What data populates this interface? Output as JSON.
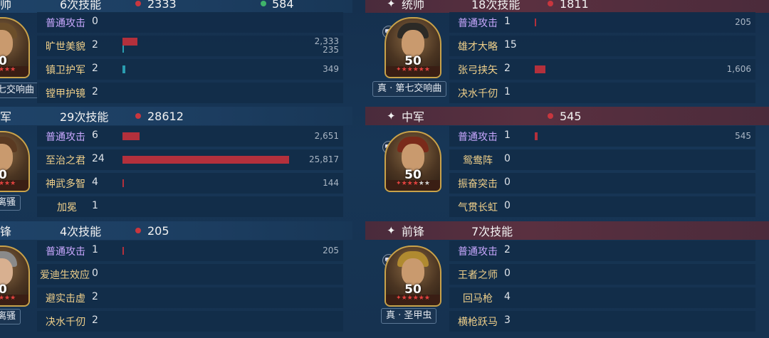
{
  "left": {
    "p1": {
      "header": {
        "role": "帅",
        "skills": "6次技能",
        "damage": "2333",
        "heal": "584"
      },
      "level": "0",
      "skills": [
        {
          "name": "普通攻击",
          "count": "0"
        },
        {
          "name": "旷世美貌",
          "count": "2",
          "value": "2,333",
          "value2": "235"
        },
        {
          "name": "镇卫护军",
          "count": "2",
          "value": "349"
        },
        {
          "name": "镗甲护镜",
          "count": "2"
        }
      ],
      "tag": "七交响曲"
    },
    "p2": {
      "header": {
        "role": "军",
        "skills": "29次技能",
        "damage": "28612"
      },
      "level": "0",
      "skills": [
        {
          "name": "普通攻击",
          "count": "6",
          "value": "2,651"
        },
        {
          "name": "至治之君",
          "count": "24",
          "value": "25,817"
        },
        {
          "name": "神武多智",
          "count": "4",
          "value": "144"
        },
        {
          "name": "加冕",
          "count": "1"
        }
      ],
      "tag": "离骚"
    },
    "p3": {
      "header": {
        "role": "锋",
        "skills": "4次技能",
        "damage": "205"
      },
      "level": "0",
      "skills": [
        {
          "name": "普通攻击",
          "count": "1",
          "value": "205"
        },
        {
          "name": "爱迪生效应",
          "count": "0"
        },
        {
          "name": "避实击虚",
          "count": "2"
        },
        {
          "name": "决水千仞",
          "count": "2"
        }
      ],
      "tag": "离骚"
    }
  },
  "right": {
    "p1": {
      "header": {
        "star": "✦",
        "role": "统帅",
        "skills": "18次技能",
        "damage": "1811"
      },
      "level": "50",
      "skills": [
        {
          "name": "普通攻击",
          "count": "1",
          "value": "205"
        },
        {
          "name": "雄才大略",
          "count": "15"
        },
        {
          "name": "张弓挟矢",
          "count": "2",
          "value": "1,606"
        },
        {
          "name": "决水千仞",
          "count": "1"
        }
      ],
      "tag": "真 · 第七交响曲"
    },
    "p2": {
      "header": {
        "star": "✦",
        "role": "中军",
        "damage": "545"
      },
      "level": "50",
      "skills": [
        {
          "name": "普通攻击",
          "count": "1",
          "value": "545"
        },
        {
          "name": "鸳鸯阵",
          "count": "0"
        },
        {
          "name": "振奋突击",
          "count": "0"
        },
        {
          "name": "气贯长虹",
          "count": "0"
        }
      ]
    },
    "p3": {
      "header": {
        "star": "✦",
        "role": "前锋",
        "skills": "7次技能"
      },
      "level": "50",
      "skills": [
        {
          "name": "普通攻击",
          "count": "2"
        },
        {
          "name": "王者之师",
          "count": "0"
        },
        {
          "name": "回马枪",
          "count": "4"
        },
        {
          "name": "横枪跃马",
          "count": "3"
        }
      ],
      "tag": "真 · 圣甲虫"
    }
  },
  "chart_data": {
    "type": "bar",
    "bars": [
      {
        "skill": "旷世美貌",
        "damage": 2333,
        "heal": 235
      },
      {
        "skill": "镇卫护军",
        "heal": 349
      },
      {
        "skill": "普通攻击(中军L)",
        "damage": 2651
      },
      {
        "skill": "至治之君",
        "damage": 25817
      },
      {
        "skill": "神武多智",
        "damage": 144
      },
      {
        "skill": "普通攻击(前锋L)",
        "damage": 205
      },
      {
        "skill": "普通攻击(统帅R)",
        "damage": 205
      },
      {
        "skill": "张弓挟矢",
        "damage": 1606
      },
      {
        "skill": "普通攻击(中军R)",
        "damage": 545
      }
    ]
  }
}
